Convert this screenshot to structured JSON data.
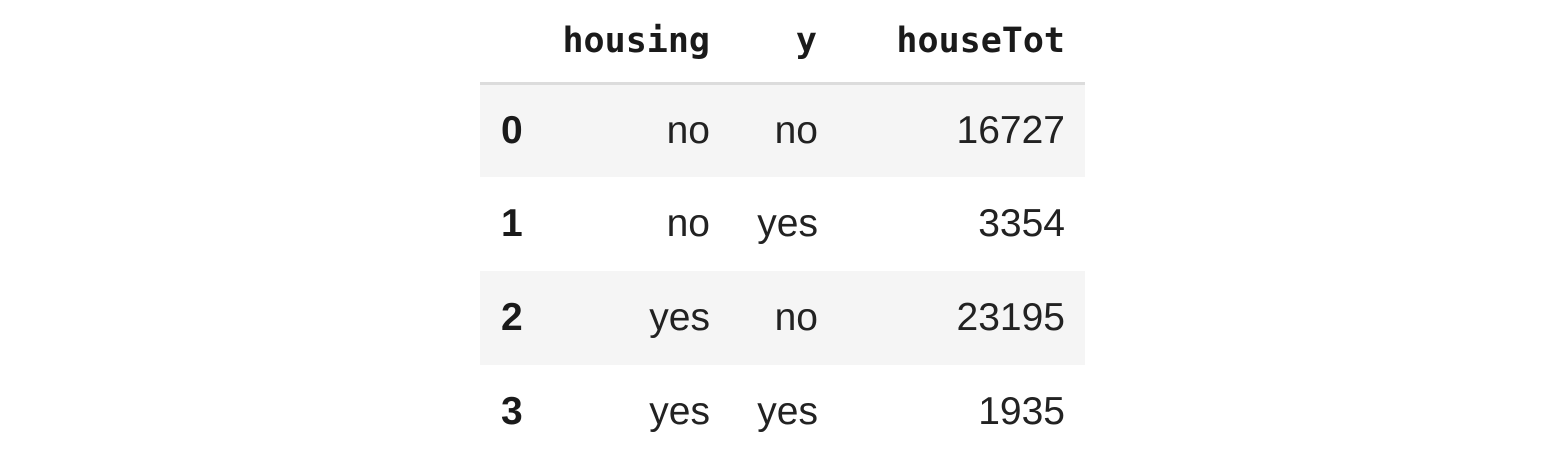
{
  "table": {
    "columns": [
      "",
      "housing",
      "y",
      "houseTot"
    ],
    "rows": [
      {
        "index": "0",
        "housing": "no",
        "y": "no",
        "houseTot": "16727"
      },
      {
        "index": "1",
        "housing": "no",
        "y": "yes",
        "houseTot": "3354"
      },
      {
        "index": "2",
        "housing": "yes",
        "y": "no",
        "houseTot": "23195"
      },
      {
        "index": "3",
        "housing": "yes",
        "y": "yes",
        "houseTot": "1935"
      }
    ]
  }
}
